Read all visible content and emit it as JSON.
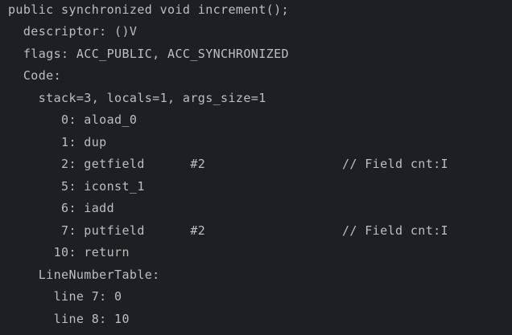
{
  "editor": {
    "lines": [
      "public synchronized void increment();",
      "  descriptor: ()V",
      "  flags: ACC_PUBLIC, ACC_SYNCHRONIZED",
      "  Code:",
      "    stack=3, locals=1, args_size=1",
      "       0: aload_0",
      "       1: dup",
      "       2: getfield      #2                  // Field cnt:I",
      "       5: iconst_1",
      "       6: iadd",
      "       7: putfield      #2                  // Field cnt:I",
      "      10: return",
      "    LineNumberTable:",
      "      line 7: 0",
      "      line 8: 10"
    ]
  },
  "theme": {
    "background": "#1e1f22",
    "text": "#bcbec4"
  }
}
